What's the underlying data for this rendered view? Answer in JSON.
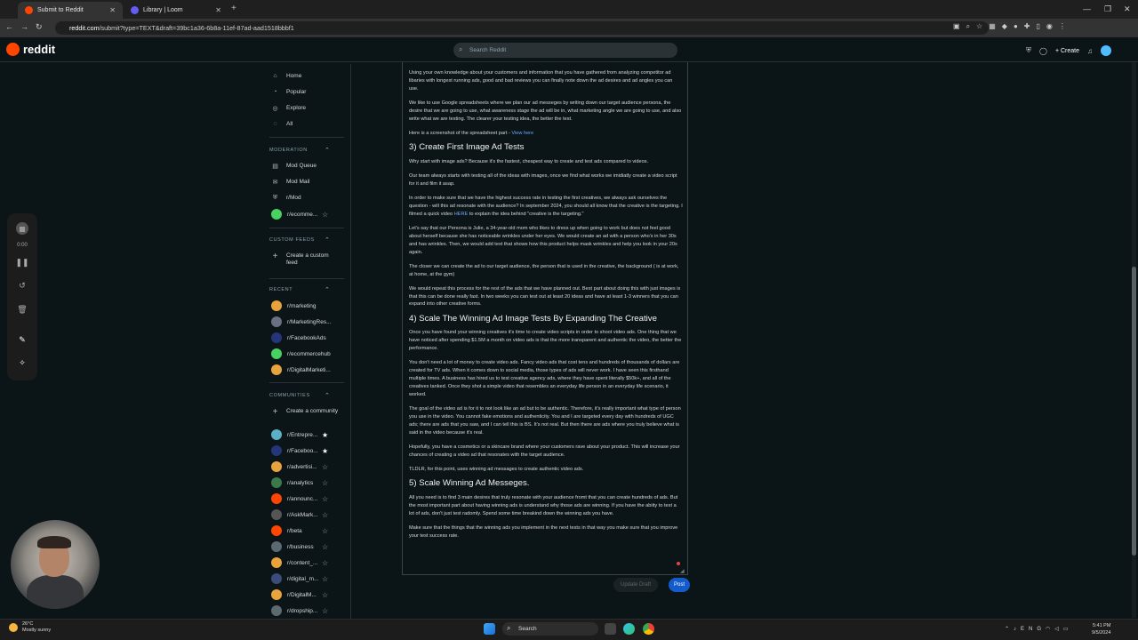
{
  "browser": {
    "tabs": [
      {
        "title": "Submit to Reddit",
        "active": true
      },
      {
        "title": "Library | Loom",
        "active": false
      }
    ],
    "url_host": "reddit.com",
    "url_path": "/submit?type=TEXT&draft=39bc1a36-6b8a-11ef-87ad-aad1518bbbf1"
  },
  "header": {
    "logo": "reddit",
    "search_placeholder": "Search Reddit",
    "create_label": "Create"
  },
  "sidebar": {
    "main": [
      "Home",
      "Popular",
      "Explore",
      "All"
    ],
    "moderation_title": "MODERATION",
    "moderation": [
      "Mod Queue",
      "Mod Mail",
      "r/Mod",
      "r/ecomme..."
    ],
    "custom_feeds_title": "CUSTOM FEEDS",
    "custom_feed_create": "Create a custom feed",
    "recent_title": "RECENT",
    "recent": [
      "r/marketing",
      "r/MarketingRes...",
      "r/FacebookAds",
      "r/ecommercehub",
      "r/DigitalMarketi..."
    ],
    "communities_title": "COMMUNITIES",
    "community_create": "Create a community",
    "communities": [
      "r/Entrepre...",
      "r/Faceboo...",
      "r/advertisi...",
      "r/analytics",
      "r/announc...",
      "r/AskMark...",
      "r/beta",
      "r/business",
      "r/content_...",
      "r/digital_m...",
      "r/DigitalM...",
      "r/dropship..."
    ]
  },
  "recorder": {
    "timer": "0:00"
  },
  "post": {
    "p1": "Using your own knowledge about your customers and information that you have gathered from analyzing competitor ad libaries with longest running ads, good and bad reviews you can finally note down the ad desires and ad angles you can use.",
    "p2": "We like to use Google spreadsheets where we plan our ad messeges by writing down our target audience persona, the desire that we are going to use, what awareness stage the ad will be in, what marketing angle we are going to use, and also write what we are testing. The clearer your testing idea, the better the test.",
    "p3": "Here is a screenshot of the spreadsheet part -",
    "p3_link": "View here",
    "h3": "3) Create First Image Ad Tests",
    "p4": "Why start with image ads? Because it's the fastest, cheapest way to create and test ads compared to videos.",
    "p5": "Our team always starts with testing all of the ideas with images, once we find what works we imidiatly create a video script for it and film it asap.",
    "p6a": "In order to make sure that we have the highest success rate in testing the first creatives, we always ask ourselves the question - will this ad resonate with the audience? In september 2024, you should all know that the creative is the targeting. I filmed a quick video",
    "p6_link": "HERE",
    "p6b": "to explain the idea behind \"creative is the targeting.\"",
    "p7": "Let's say that our Persona is Julie, a 34-year-old mom who likes to dress up when going to work but does not feel good about herself because she has noticeable wrinkles under her eyes. We would create an ad with a person who's in her 30s and has wrinkles. Then, we would add text that shows how this product helps mask wrinkles and help you look in your 20s again.",
    "p8": "The closer we can create the ad to our target audience, the person that is used in the creative, the background ( is at work, at home, at the gym)",
    "p9": "We would repeat this process for the rest of the ads that we have planned out. Best part about doing this with just images is that this can be done really fast. In two weeks you can test out at least 20 ideas and have at least 1-3 winners that you can expand into other creative forms.",
    "h4": "4) Scale The Winning Ad Image Tests By Expanding The Creative",
    "p10": "Once you have found your winning creatives it's time to create video scripts in order to shoot video ads. One thing that we have noticed after spending $1.5M a month on video ads is that the more transparent and authentic the video, the better the performance.",
    "p11": "You don't need a lot of money to create video ads. Fancy video ads that cost tens and hundreds of thousands of dollars are created for TV ads. When it comes down to social media, those types of ads will never work. I have seen this firsthand multiple times. A business has hired us to test creative agency ads, where they have spent literally $50k+, and all of the creatives tanked. Once they shot a simple video that resembles an everyday life person in an everyday life scenario, it worked.",
    "p12": "The goal of the video ad is for it to not look like an ad but to be authentic. Therefore, it's really important what type of person you use in the video. You cannot fake emotions and authenticity. You and I are targeted every day with hundreds of UGC ads; there are ads that you saw, and I can tell this is BS. It's not real. But then there are ads where you truly believe what is said in the video because it's real.",
    "p13": "Hopefully, you have a cosmetics or a skincare brand where your customers rave about your product. This will increase your chances of creating a video ad that resonates with the target audience.",
    "p14": "TLDLR, for this point, uses winning ad messages to create authentic video ads.",
    "h5": "5) Scale Winning Ad Messeges.",
    "p15": "All you need is to find 3 main desires that truly resonate with your audience fromt that you can create hundreds of ads. But the most important part about having winning ads is understand why those ads are winning. If you have the abiity to test a lot of ads, don't just test radomly. Spend some time breakind down the winning ads you have.",
    "p16": "Make sure that the things that the winning ads you implement in the next tests in that way you make sure that you improve your test success rate."
  },
  "actions": {
    "update_draft": "Update Draft",
    "post": "Post"
  },
  "taskbar": {
    "weather_temp": "26°C",
    "weather_desc": "Mostly sunny",
    "search": "Search",
    "lang": "ENG",
    "time": "5:41 PM",
    "date": "9/5/2024"
  },
  "colors": {
    "reddit_orange": "#ff4500",
    "post_button": "#115bca",
    "link": "#6fa8ff"
  }
}
